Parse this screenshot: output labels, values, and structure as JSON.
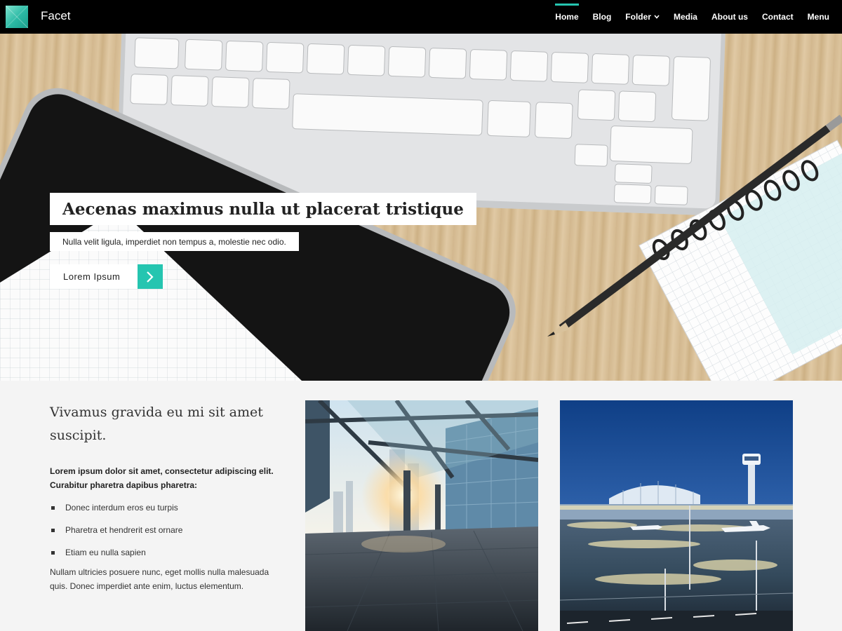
{
  "header": {
    "site_title": "Facet",
    "nav": [
      {
        "label": "Home",
        "active": true
      },
      {
        "label": "Blog"
      },
      {
        "label": "Folder",
        "has_dropdown": true
      },
      {
        "label": "Media"
      },
      {
        "label": "About us"
      },
      {
        "label": "Contact"
      },
      {
        "label": "Menu"
      }
    ]
  },
  "hero": {
    "title": "Aecenas maximus nulla ut placerat tristique",
    "subtitle": "Nulla velit ligula, imperdiet non tempus a, molestie nec odio.",
    "cta_label": "Lorem Ipsum",
    "cta_icon": "chevron-right-icon"
  },
  "content": {
    "heading": "Vivamus gravida eu mi sit amet suscipit.",
    "intro": "Lorem ipsum dolor sit amet, consectetur adipiscing elit. Curabitur pharetra dapibus pharetra:",
    "bullets": [
      "Donec interdum eros eu turpis",
      "Pharetra et hendrerit est ornare",
      "Etiam eu nulla sapien"
    ],
    "outro": "Nullam ultricies posuere nunc, eget mollis nulla malesuada quis. Donec imperdiet ante enim, luctus elementum."
  },
  "colors": {
    "accent": "#25c5b0",
    "header_bg": "#000000",
    "page_bg": "#f4f4f4"
  }
}
